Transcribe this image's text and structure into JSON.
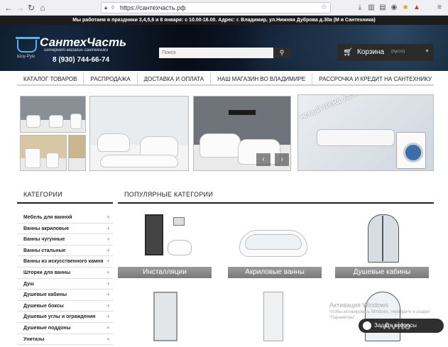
{
  "browser": {
    "url": "https://сантехчасть.рф",
    "nav": {
      "back": "←",
      "forward": "→",
      "reload": "↻",
      "home": "⌂"
    },
    "icons": [
      "shield-icon",
      "bookmark-star-icon",
      "downloads-icon",
      "library-icon",
      "reader-icon",
      "account-icon",
      "extension-icon",
      "menu-icon"
    ]
  },
  "header": {
    "notice": "Мы работаем в праздники 3,4,5,6 и 8 января: с 10.00-16.00. Адрес: г. Владимир, ул.Нижняя Дуброва д.30а (М и Сантехника)",
    "logo_title": "СантехЧасть",
    "logo_subtitle": "интернет-магазин сантехники",
    "showroom": "Шоу-Рум",
    "phone": "8 (930) 744-66-74",
    "search_placeholder": "Поиск",
    "cart_label": "Корзина",
    "cart_status": "(пусто)"
  },
  "menu": [
    "Каталог товаров",
    "Распродажа",
    "Доставка и оплата",
    "Наш магазин во Владимире",
    "Рассрочка и кредит на сантехнику"
  ],
  "banner": {
    "slogan": "НОВЫЙ ТРЕНД. УДОБСТВО И ЭСТЕТИКА."
  },
  "sidebar": {
    "title": "Категории",
    "items": [
      "Мебель для ванной",
      "Ванны акриловые",
      "Ванны чугунные",
      "Ванны стальные",
      "Ванны из искусственного камня",
      "Шторки для ванны",
      "Душ",
      "Душевые кабины",
      "Душевые боксы",
      "Душевые углы и ограждения",
      "Душевые поддоны",
      "Унитазы"
    ]
  },
  "popular": {
    "title": "Популярные категории",
    "cards": [
      "Инсталляции",
      "Акриловые ванны",
      "Душевые кабины"
    ]
  },
  "overlay": {
    "activation_title": "Активация Windows",
    "activation_text": "Чтобы активировать Windows, перейдите в раздел \"Параметры\".",
    "help_button": "Задать вопросы",
    "watermark": "Avito"
  },
  "colors": {
    "header_bg": "#050a12",
    "accent": "#5bb3e6",
    "menu_text": "#222222",
    "label_bg": "#8a8a8a"
  }
}
